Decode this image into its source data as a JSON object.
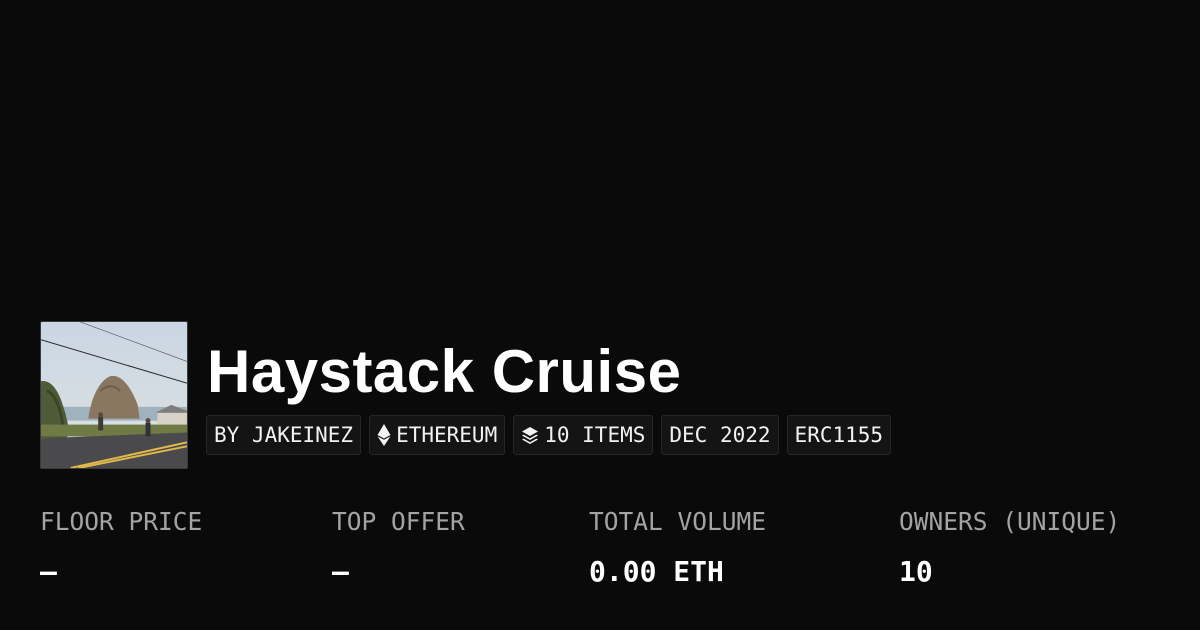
{
  "collection": {
    "title": "Haystack Cruise",
    "badges": {
      "creator": "BY JAKEINEZ",
      "chain": "ETHEREUM",
      "items": "10 ITEMS",
      "date": "DEC 2022",
      "standard": "ERC1155"
    },
    "icons": {
      "chain": "ethereum-icon",
      "items": "layers-icon"
    }
  },
  "stats": [
    {
      "label": "FLOOR PRICE",
      "value": "—"
    },
    {
      "label": "TOP OFFER",
      "value": "—"
    },
    {
      "label": "TOTAL VOLUME",
      "value": "0.00 ETH"
    },
    {
      "label": "OWNERS (UNIQUE)",
      "value": "10"
    }
  ],
  "colors": {
    "background": "#0a0a0a",
    "badge_bg": "#141414",
    "label": "#a3a3a3",
    "text": "#ffffff"
  }
}
